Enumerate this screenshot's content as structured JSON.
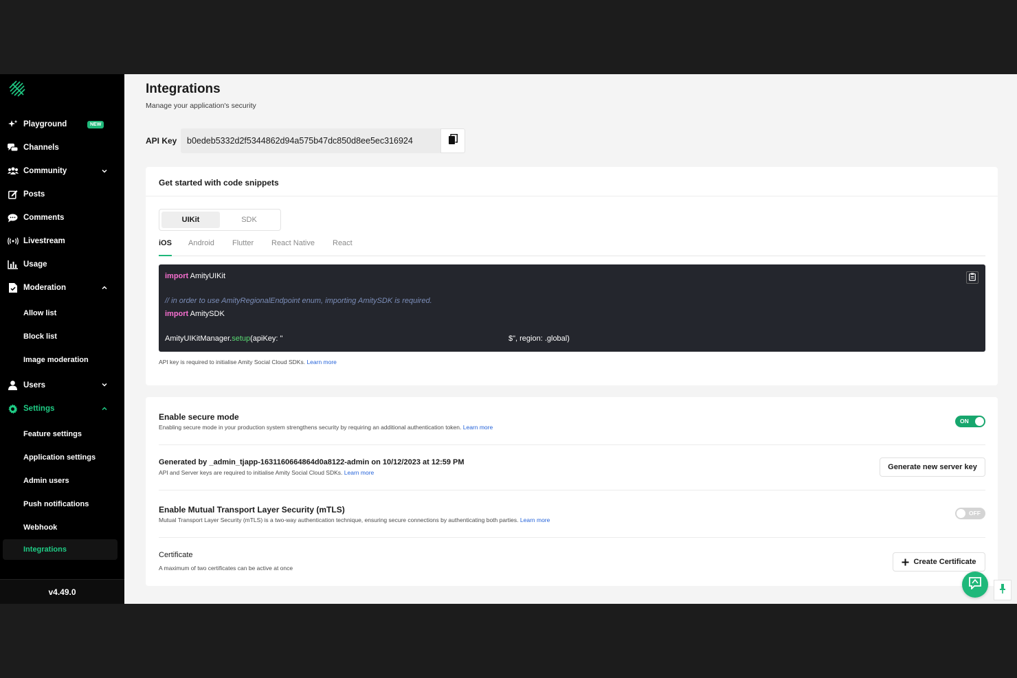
{
  "sidebar": {
    "logo": "amity-logo-icon",
    "items": [
      {
        "label": "Playground",
        "badge": "NEW"
      },
      {
        "label": "Channels"
      },
      {
        "label": "Community"
      },
      {
        "label": "Posts"
      },
      {
        "label": "Comments"
      },
      {
        "label": "Livestream"
      },
      {
        "label": "Usage"
      },
      {
        "label": "Moderation"
      },
      {
        "label": "Users"
      },
      {
        "label": "Settings"
      }
    ],
    "moderation_sub": [
      "Allow list",
      "Block list",
      "Image moderation"
    ],
    "settings_sub": [
      "Feature settings",
      "Application settings",
      "Admin users",
      "Push notifications",
      "Webhook",
      "Integrations"
    ],
    "version": "v4.49.0"
  },
  "page": {
    "title": "Integrations",
    "subtitle": "Manage your application's security"
  },
  "api_key": {
    "label": "API Key",
    "value": "b0edeb5332d2f5344862d94a575b47dc850d8ee5ec316924"
  },
  "snippets": {
    "title": "Get started with code snippets",
    "segments": [
      "UIKit",
      "SDK"
    ],
    "tabs": [
      "iOS",
      "Android",
      "Flutter",
      "React Native",
      "React"
    ],
    "code": {
      "l1_kw": "import",
      "l1_rest": " AmityUIKit",
      "l2_comment": "// in order to use AmityRegionalEndpoint enum, importing AmitySDK is required.",
      "l3_kw": "import",
      "l3_rest": " AmitySDK",
      "l4_obj": "AmityUIKitManager.",
      "l4_fn": "setup",
      "l4_args": "(apiKey: \"",
      "l4_tail": "$\", region: .global)"
    },
    "note": "API key is required to initialise Amity Social Cloud SDKs.",
    "note_link": "Learn more"
  },
  "security": {
    "secure_mode": {
      "title": "Enable secure mode",
      "desc": "Enabling secure mode in your production system strengthens security by requiring an additional authentication token.",
      "link": "Learn more",
      "toggle": "ON"
    },
    "server_key": {
      "title": "Generated by _admin_tjapp-1631160664864d0a8122-admin on 10/12/2023 at 12:59 PM",
      "desc": "API and Server keys are required to initialise Amity Social Cloud SDKs.",
      "link": "Learn more",
      "button": "Generate new server key"
    },
    "mtls": {
      "title": "Enable Mutual Transport Layer Security (mTLS)",
      "desc": "Mutual Transport Layer Security (mTLS) is a two-way authentication technique, ensuring secure connections by authenticating both parties.",
      "link": "Learn more",
      "toggle": "OFF"
    },
    "certificate": {
      "title": "Certificate",
      "desc": "A maximum of two certificates can be active at once",
      "button": "Create Certificate"
    }
  },
  "colors": {
    "accent": "#1fb87a",
    "sidebar_bg": "#000000",
    "code_bg": "#24262d"
  }
}
